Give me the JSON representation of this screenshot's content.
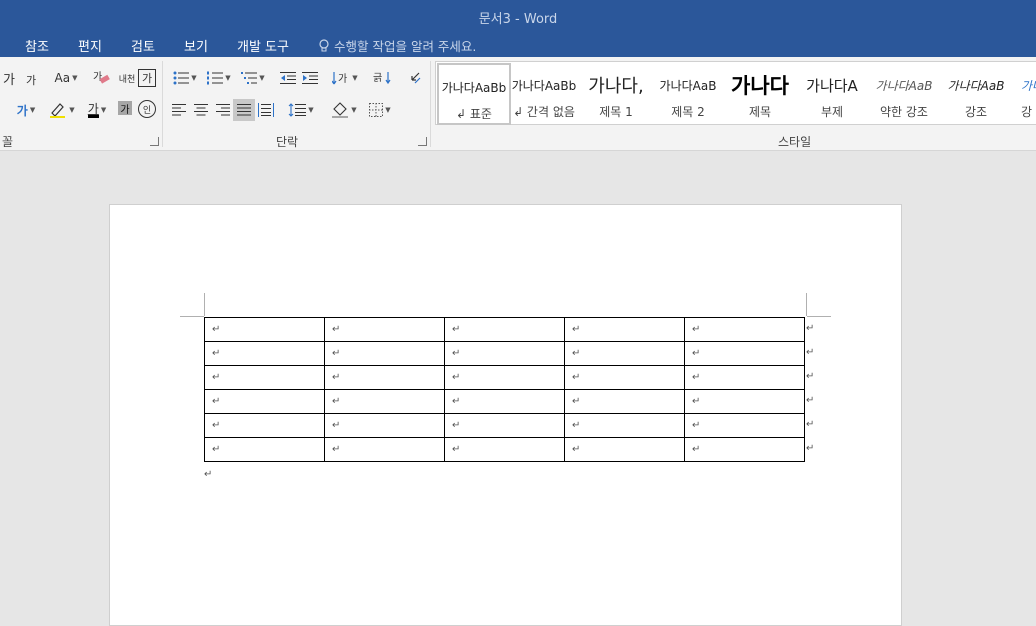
{
  "window": {
    "title": "문서3 - Word"
  },
  "tabs": [
    {
      "label": "참조"
    },
    {
      "label": "편지"
    },
    {
      "label": "검토"
    },
    {
      "label": "보기"
    },
    {
      "label": "개발 도구"
    }
  ],
  "tell_me": {
    "placeholder": "수행할 작업을 알려 주세요."
  },
  "ribbon": {
    "font_group": {
      "label": "꼴",
      "icons": [
        "grow-font-icon",
        "shrink-font-icon",
        "change-case-icon",
        "clear-formatting-icon",
        "phonetic-guide-icon",
        "character-border-icon",
        "text-effects-icon",
        "highlight-icon",
        "font-color-icon",
        "character-shading-icon",
        "enclose-characters-icon"
      ],
      "grow_text": "가",
      "shrink_text": "가",
      "case_text": "Aa",
      "phonetic_text": "내천",
      "border_text": "가",
      "font_color_text": "가",
      "shading_text": "가",
      "enclose_text": "인"
    },
    "paragraph_group": {
      "label": "단락",
      "icons": [
        "bullets-icon",
        "numbering-icon",
        "multilevel-list-icon",
        "decrease-indent-icon",
        "increase-indent-icon",
        "text-direction-icon",
        "sort-icon",
        "show-marks-icon",
        "align-left-icon",
        "center-icon",
        "align-right-icon",
        "justify-icon",
        "distributed-icon",
        "line-spacing-icon",
        "shading-icon",
        "borders-icon"
      ]
    },
    "styles_group": {
      "label": "스타일",
      "styles": [
        {
          "preview": "가나다AaBb",
          "name": "↲ 표준",
          "selected": true
        },
        {
          "preview": "가나다AaBb",
          "name": "↲ 간격 없음",
          "selected": false
        },
        {
          "preview": "가나다,",
          "name": "제목 1",
          "selected": false
        },
        {
          "preview": "가나다AaB",
          "name": "제목 2",
          "selected": false
        },
        {
          "preview": "가나다",
          "name": "제목",
          "selected": false
        },
        {
          "preview": "가나다A",
          "name": "부제",
          "selected": false
        },
        {
          "preview": "가나다AaB",
          "name": "약한 강조",
          "selected": false
        },
        {
          "preview": "가나다AaB",
          "name": "강조",
          "selected": false
        },
        {
          "preview": "가나",
          "name": "강",
          "selected": false
        }
      ]
    }
  },
  "document": {
    "table": {
      "rows": 6,
      "cols": 5,
      "cells": [
        [
          "↵",
          "↵",
          "↵",
          "↵",
          "↵"
        ],
        [
          "↵",
          "↵",
          "↵",
          "↵",
          "↵"
        ],
        [
          "↵",
          "↵",
          "↵",
          "↵",
          "↵"
        ],
        [
          "↵",
          "↵",
          "↵",
          "↵",
          "↵"
        ],
        [
          "↵",
          "↵",
          "↵",
          "↵",
          "↵"
        ],
        [
          "↵",
          "↵",
          "↵",
          "↵",
          "↵"
        ]
      ],
      "row_end_mark": "↵"
    },
    "paragraph_mark": "↵"
  },
  "colors": {
    "titlebar": "#2b579a",
    "ribbon": "#f3f3f3",
    "canvas": "#e6e6e6"
  }
}
